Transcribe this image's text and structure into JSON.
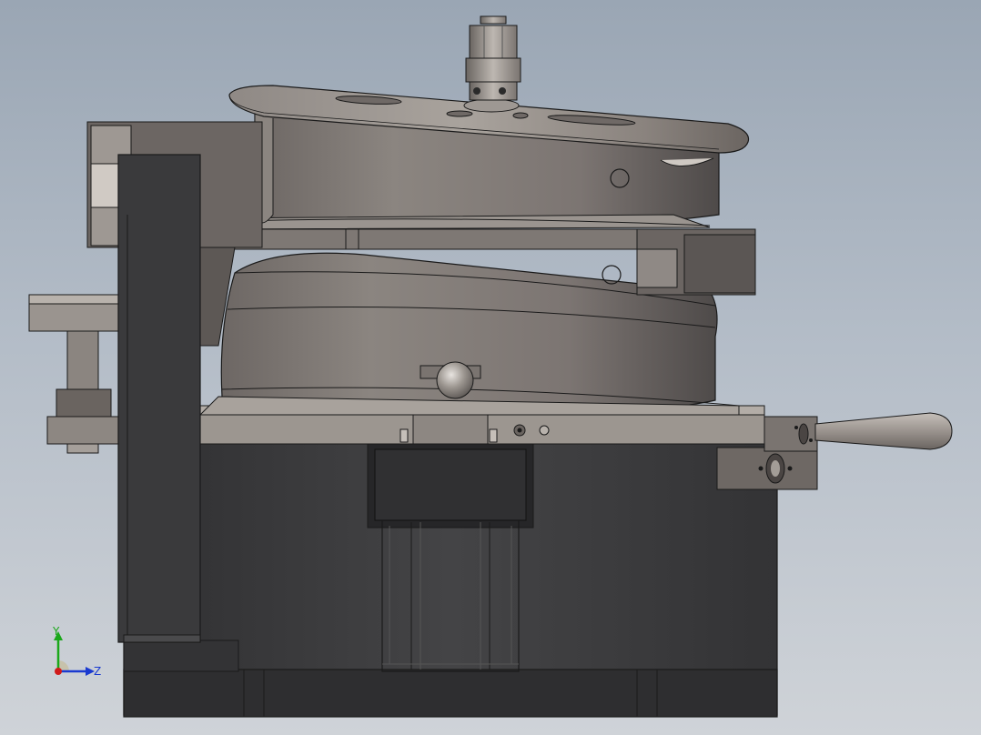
{
  "viewport": {
    "background_top": "#9aa6b4",
    "background_bottom": "#cfd3d8"
  },
  "triad": {
    "y_label": "Y",
    "z_label": "Z",
    "y_color": "#1aa81a",
    "z_color": "#1a3ad0",
    "x_color": "#d01a1a"
  },
  "colors": {
    "dark_body": "#3a3a3c",
    "metal": "#8c8580",
    "metal_light": "#b7b1ab",
    "metal_dark": "#5f5a57",
    "edge": "#1a1a1a"
  }
}
